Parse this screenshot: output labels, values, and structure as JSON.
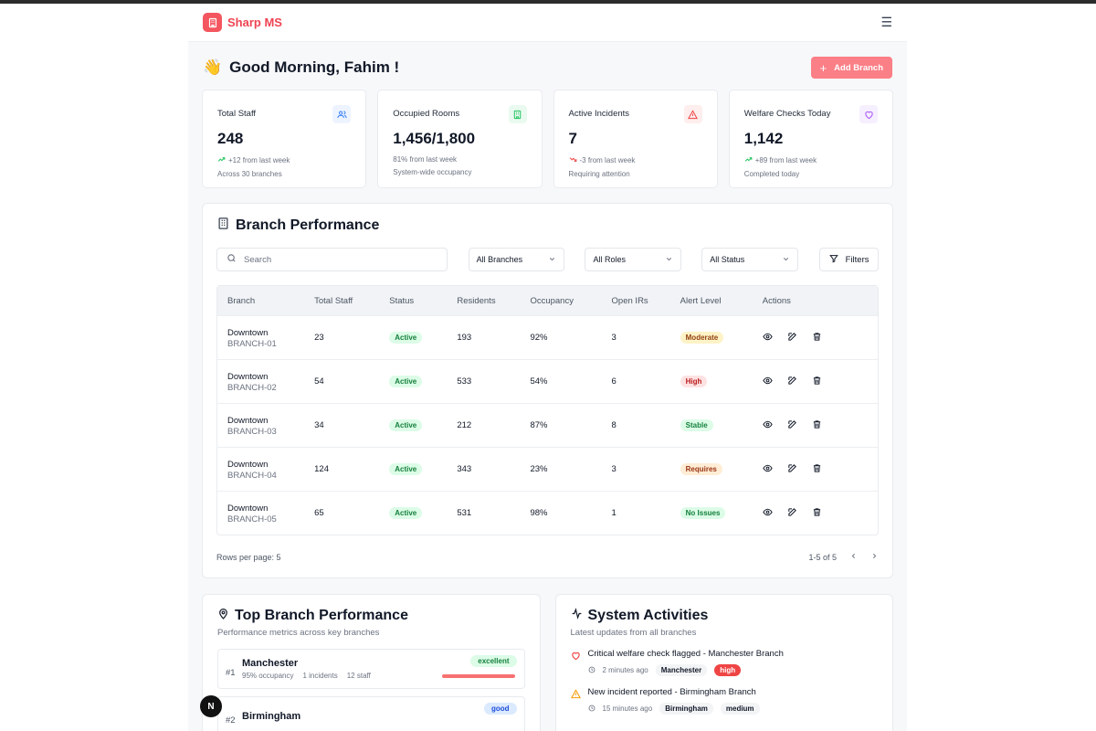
{
  "app": {
    "name": "Sharp MS"
  },
  "greeting": {
    "emoji": "👋",
    "text": "Good Morning, Fahim !"
  },
  "actions": {
    "add_branch": "Add Branch"
  },
  "stats": [
    {
      "title": "Total Staff",
      "value": "248",
      "change": "+12 from last week",
      "trend": "up",
      "sub": "Across 30 branches",
      "icon": "users-icon",
      "color": "#3b82f6"
    },
    {
      "title": "Occupied Rooms",
      "value": "1,456/1,800",
      "change": "81% from last week",
      "trend": "none",
      "sub": "System-wide occupancy",
      "icon": "building-icon",
      "color": "#22c55e"
    },
    {
      "title": "Active Incidents",
      "value": "7",
      "change": "-3 from last week",
      "trend": "down",
      "sub": "Requiring attention",
      "icon": "alert-triangle-icon",
      "color": "#ef4444"
    },
    {
      "title": "Welfare Checks Today",
      "value": "1,142",
      "change": "+89 from last week",
      "trend": "up",
      "sub": "Completed today",
      "icon": "heart-icon",
      "color": "#a855f7"
    }
  ],
  "branch_performance": {
    "title": "Branch Performance",
    "search_placeholder": "Search",
    "filters": [
      "All Branches",
      "All Roles",
      "All Status"
    ],
    "filters_button": "Filters",
    "columns": [
      "Branch",
      "Total Staff",
      "Status",
      "Residents",
      "Occupancy",
      "Open IRs",
      "Alert Level",
      "Actions"
    ],
    "rows": [
      {
        "name": "Downtown",
        "code": "BRANCH-01",
        "staff": "23",
        "status": "Active",
        "residents": "193",
        "occupancy": "92%",
        "irs": "3",
        "alert": "Moderate",
        "alert_bg": "#fef3c7",
        "alert_fg": "#92400e"
      },
      {
        "name": "Downtown",
        "code": "BRANCH-02",
        "staff": "54",
        "status": "Active",
        "residents": "533",
        "occupancy": "54%",
        "irs": "6",
        "alert": "High",
        "alert_bg": "#fee2e2",
        "alert_fg": "#b91c1c"
      },
      {
        "name": "Downtown",
        "code": "BRANCH-03",
        "staff": "34",
        "status": "Active",
        "residents": "212",
        "occupancy": "87%",
        "irs": "8",
        "alert": "Stable",
        "alert_bg": "#dcfce7",
        "alert_fg": "#15803d"
      },
      {
        "name": "Downtown",
        "code": "BRANCH-04",
        "staff": "124",
        "status": "Active",
        "residents": "343",
        "occupancy": "23%",
        "irs": "3",
        "alert": "Requires",
        "alert_bg": "#ffedd5",
        "alert_fg": "#9a3412"
      },
      {
        "name": "Downtown",
        "code": "BRANCH-05",
        "staff": "65",
        "status": "Active",
        "residents": "531",
        "occupancy": "98%",
        "irs": "1",
        "alert": "No Issues",
        "alert_bg": "#dcfce7",
        "alert_fg": "#15803d"
      }
    ],
    "rows_per_page": "Rows per page: 5",
    "range": "1-5 of 5"
  },
  "top_branches": {
    "title": "Top Branch Performance",
    "subtitle": "Performance metrics across key branches",
    "items": [
      {
        "rank": "#1",
        "name": "Manchester",
        "occupancy": "95% occupancy",
        "incidents": "1 incidents",
        "staff": "12 staff",
        "badge": "excellent",
        "badge_bg": "#dcfce7",
        "badge_fg": "#15803d",
        "progress": 0.95
      },
      {
        "rank": "#2",
        "name": "Birmingham",
        "badge": "good",
        "badge_bg": "#dbeafe",
        "badge_fg": "#1d4ed8"
      }
    ]
  },
  "activities": {
    "title": "System Activities",
    "subtitle": "Latest updates from all branches",
    "items": [
      {
        "title": "Critical welfare check flagged - Manchester Branch",
        "time": "2 minutes ago",
        "branch": "Manchester",
        "severity": "high",
        "icon": "heart-icon",
        "icon_color": "#ef4444"
      },
      {
        "title": "New incident reported - Birmingham Branch",
        "time": "15 minutes ago",
        "branch": "Birmingham",
        "severity": "medium",
        "icon": "alert-triangle-icon",
        "icon_color": "#f59e0b"
      }
    ]
  },
  "fab": {
    "label": "N"
  }
}
